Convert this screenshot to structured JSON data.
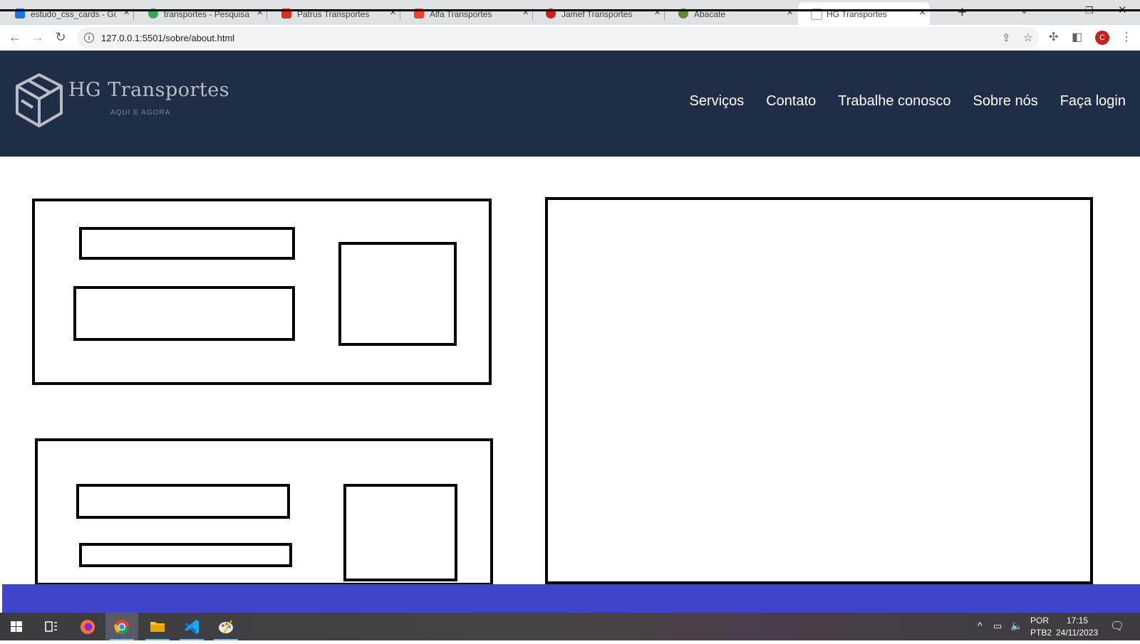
{
  "browser": {
    "tabs": [
      {
        "title": "estudo_css_cards - Go",
        "favicon_color": "#1a73e8"
      },
      {
        "title": "transportes - Pesquisa",
        "favicon_color": "#34a853"
      },
      {
        "title": "Patrus Transportes",
        "favicon_color": "#d93025"
      },
      {
        "title": "Alfa Transportes",
        "favicon_color": "#ea4335"
      },
      {
        "title": "Jamef Transportes",
        "favicon_color": "#c5221f"
      },
      {
        "title": "Abacate",
        "favicon_color": "#5f8a2e"
      },
      {
        "title": "HG Transportes",
        "favicon_color": "#9aa0a6"
      }
    ],
    "url": "127.0.0.1:5501/sobre/about.html",
    "profile_initial": "C"
  },
  "site": {
    "brand": "HG Transportes",
    "tagline": "AQUI E AGORA",
    "nav": [
      "Serviços",
      "Contato",
      "Trabalhe conosco",
      "Sobre nós",
      "Faça login"
    ]
  },
  "taskbar": {
    "language": "POR",
    "layout": "PTB2",
    "time": "17:15",
    "date": "24/11/2023"
  },
  "colors": {
    "header_bg": "#1f2d47",
    "footer_band": "#3e45cb",
    "wireframe_stroke": "#000000"
  }
}
